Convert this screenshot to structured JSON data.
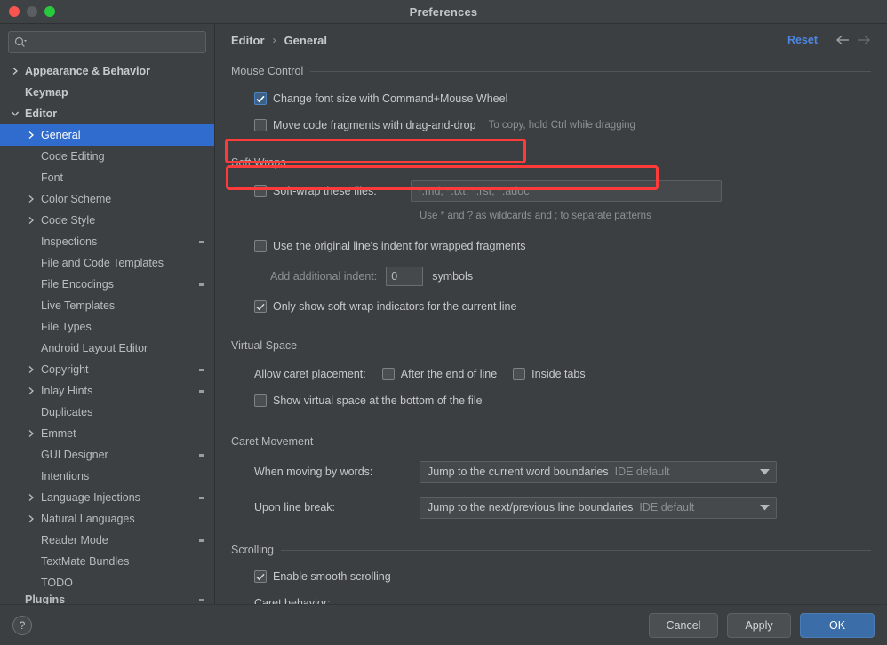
{
  "window": {
    "title": "Preferences",
    "traffic_lights": [
      "close",
      "minimize",
      "zoom"
    ]
  },
  "sidebar": {
    "search": {
      "value": "",
      "placeholder": ""
    },
    "items": [
      {
        "label": "Appearance & Behavior",
        "depth": 0,
        "twisty": "right",
        "top": true,
        "module_icon": false
      },
      {
        "label": "Keymap",
        "depth": 0,
        "twisty": "none",
        "top": true,
        "module_icon": false
      },
      {
        "label": "Editor",
        "depth": 0,
        "twisty": "down",
        "top": true,
        "module_icon": false
      },
      {
        "label": "General",
        "depth": 1,
        "twisty": "right",
        "top": false,
        "module_icon": false,
        "selected": true
      },
      {
        "label": "Code Editing",
        "depth": 1,
        "twisty": "none",
        "top": false,
        "module_icon": false
      },
      {
        "label": "Font",
        "depth": 1,
        "twisty": "none",
        "top": false,
        "module_icon": false
      },
      {
        "label": "Color Scheme",
        "depth": 1,
        "twisty": "right",
        "top": false,
        "module_icon": false
      },
      {
        "label": "Code Style",
        "depth": 1,
        "twisty": "right",
        "top": false,
        "module_icon": false
      },
      {
        "label": "Inspections",
        "depth": 1,
        "twisty": "none",
        "top": false,
        "module_icon": true
      },
      {
        "label": "File and Code Templates",
        "depth": 1,
        "twisty": "none",
        "top": false,
        "module_icon": false
      },
      {
        "label": "File Encodings",
        "depth": 1,
        "twisty": "none",
        "top": false,
        "module_icon": true
      },
      {
        "label": "Live Templates",
        "depth": 1,
        "twisty": "none",
        "top": false,
        "module_icon": false
      },
      {
        "label": "File Types",
        "depth": 1,
        "twisty": "none",
        "top": false,
        "module_icon": false
      },
      {
        "label": "Android Layout Editor",
        "depth": 1,
        "twisty": "none",
        "top": false,
        "module_icon": false
      },
      {
        "label": "Copyright",
        "depth": 1,
        "twisty": "right",
        "top": false,
        "module_icon": true
      },
      {
        "label": "Inlay Hints",
        "depth": 1,
        "twisty": "right",
        "top": false,
        "module_icon": true
      },
      {
        "label": "Duplicates",
        "depth": 1,
        "twisty": "none",
        "top": false,
        "module_icon": false
      },
      {
        "label": "Emmet",
        "depth": 1,
        "twisty": "right",
        "top": false,
        "module_icon": false
      },
      {
        "label": "GUI Designer",
        "depth": 1,
        "twisty": "none",
        "top": false,
        "module_icon": true
      },
      {
        "label": "Intentions",
        "depth": 1,
        "twisty": "none",
        "top": false,
        "module_icon": false
      },
      {
        "label": "Language Injections",
        "depth": 1,
        "twisty": "right",
        "top": false,
        "module_icon": true
      },
      {
        "label": "Natural Languages",
        "depth": 1,
        "twisty": "right",
        "top": false,
        "module_icon": false
      },
      {
        "label": "Reader Mode",
        "depth": 1,
        "twisty": "none",
        "top": false,
        "module_icon": true
      },
      {
        "label": "TextMate Bundles",
        "depth": 1,
        "twisty": "none",
        "top": false,
        "module_icon": false
      },
      {
        "label": "TODO",
        "depth": 1,
        "twisty": "none",
        "top": false,
        "module_icon": false
      },
      {
        "label": "Plugins",
        "depth": 0,
        "twisty": "none",
        "top": true,
        "module_icon": true,
        "clipped": true
      }
    ]
  },
  "header": {
    "breadcrumb": [
      "Editor",
      "General"
    ],
    "separator": "›",
    "reset_label": "Reset",
    "back_arrow": "←",
    "forward_arrow": "→"
  },
  "sections": {
    "mouse_control": {
      "title": "Mouse Control",
      "change_font_size": {
        "label": "Change font size with Command+Mouse Wheel",
        "checked": true,
        "highlighted": true
      },
      "move_code_fragments": {
        "label": "Move code fragments with drag-and-drop",
        "checked": false,
        "hint": "To copy, hold Ctrl while dragging",
        "highlighted": true
      }
    },
    "soft_wraps": {
      "title": "Soft Wraps",
      "soft_wrap_files": {
        "label": "Soft-wrap these files:",
        "checked": false,
        "value": "*.md; *.txt; *.rst; *.adoc"
      },
      "wildcard_hint": "Use * and ? as wildcards and ; to separate patterns",
      "original_indent": {
        "label": "Use the original line's indent for wrapped fragments",
        "checked": false
      },
      "additional_indent": {
        "label": "Add additional indent:",
        "value": "0",
        "suffix": "symbols"
      },
      "only_show_indicators": {
        "label": "Only show soft-wrap indicators for the current line",
        "checked": true
      }
    },
    "virtual_space": {
      "title": "Virtual Space",
      "allow_caret_label": "Allow caret placement:",
      "after_end_of_line": {
        "label": "After the end of line",
        "checked": false
      },
      "inside_tabs": {
        "label": "Inside tabs",
        "checked": false
      },
      "show_virtual_space": {
        "label": "Show virtual space at the bottom of the file",
        "checked": false
      }
    },
    "caret_movement": {
      "title": "Caret Movement",
      "when_moving_by_words": {
        "label": "When moving by words:",
        "value": "Jump to the current word boundaries",
        "sub": "IDE default"
      },
      "upon_line_break": {
        "label": "Upon line break:",
        "value": "Jump to the next/previous line boundaries",
        "sub": "IDE default"
      }
    },
    "scrolling": {
      "title": "Scrolling",
      "enable_smooth_scrolling": {
        "label": "Enable smooth scrolling",
        "checked": true
      },
      "caret_behavior_label": "Caret behavior:"
    }
  },
  "footer": {
    "help": "?",
    "cancel": "Cancel",
    "apply": "Apply",
    "ok": "OK"
  },
  "colors": {
    "accent_blue": "#2f6cce",
    "link_blue": "#4d86e0",
    "highlight_red": "#fd3b3b",
    "window_bg": "#3c3f41",
    "sidebar_bg": "#3c4043"
  }
}
